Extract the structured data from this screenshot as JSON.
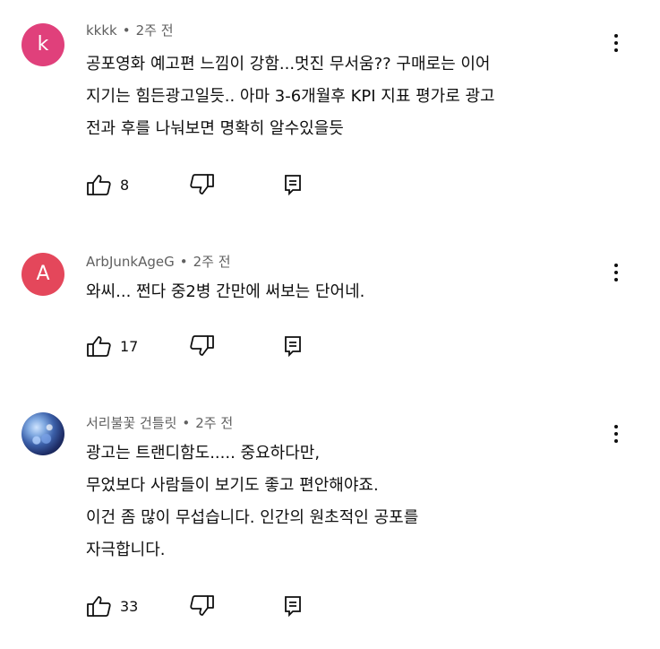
{
  "comments": [
    {
      "avatar_letter": "k",
      "avatar_color": "#e0407b",
      "author": "kkkk",
      "separator": "•",
      "time": "2주 전",
      "lines": [
        "공포영화 예고편 느낌이 강함...멋진 무서움?? 구매로는 이어",
        "지기는 힘든광고일듯.. 아마 3-6개월후 KPI 지표 평가로 광고",
        "전과 후를 나눠보면 명확히 알수있을듯"
      ],
      "likes": "8"
    },
    {
      "avatar_letter": "A",
      "avatar_color": "#e4475b",
      "author": "ArbJunkAgeG",
      "separator": "•",
      "time": "2주 전",
      "lines": [
        "와씨... 쩐다 중2병 간만에 써보는 단어네."
      ],
      "likes": "17"
    },
    {
      "avatar_letter": "",
      "avatar_color": "#2a3f85",
      "author": "서리불꽃 건틀릿",
      "separator": "•",
      "time": "2주 전",
      "lines": [
        "광고는 트랜디함도..... 중요하다만,",
        "무었보다 사람들이 보기도 좋고 편안해야죠.",
        "이건 좀 많이 무섭습니다. 인간의 원초적인 공포를",
        "자극합니다."
      ],
      "likes": "33"
    }
  ],
  "icons": {
    "like": "thumb-up-icon",
    "dislike": "thumb-down-icon",
    "reply": "reply-icon",
    "more": "more-vertical-icon"
  }
}
